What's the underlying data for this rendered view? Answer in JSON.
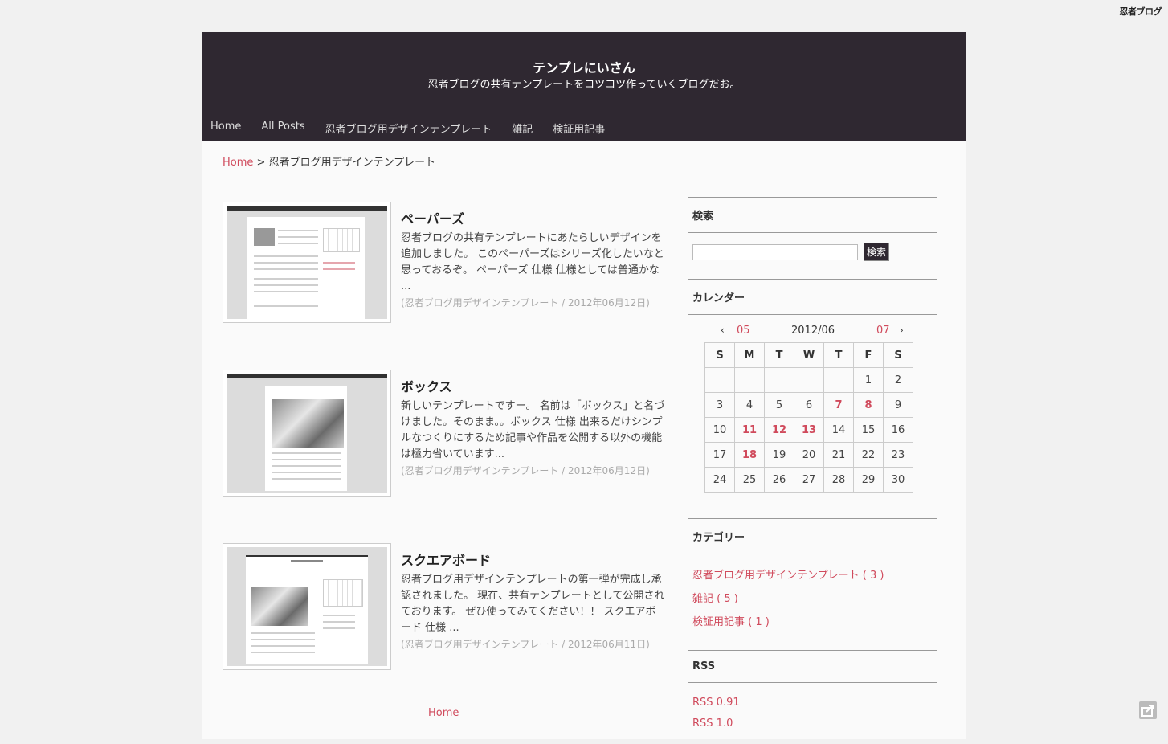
{
  "top_logo": "忍者ブログ",
  "header": {
    "title": "テンプレにいさん",
    "description": "忍者ブログの共有テンプレートをコツコツ作っていくブログだお。",
    "nav": [
      "Home",
      "All Posts",
      "忍者ブログ用デザインテンプレート",
      "雑記",
      "検証用記事"
    ]
  },
  "breadcrumb": {
    "home": "Home",
    "separator": " > ",
    "current": "忍者ブログ用デザインテンプレート"
  },
  "posts": [
    {
      "title": "ペーパーズ",
      "body": "忍者ブログの共有テンプレートにあたらしいデザインを追加しました。 このペーパーズはシリーズ化したいなと思っておるぞ。 ペーパーズ 仕様 仕様としては普通かな ...",
      "meta": "(忍者ブログ用デザインテンプレート / 2012年06月12日)"
    },
    {
      "title": "ボックス",
      "body": "新しいテンプレートですー。 名前は「ボックス」と名づけました。そのまま。。ボックス 仕様 出来るだけシンプルなつくりにするため記事や作品を公開する以外の機能は極力省いています...",
      "meta": "(忍者ブログ用デザインテンプレート / 2012年06月12日)"
    },
    {
      "title": "スクエアボード",
      "body": "忍者ブログ用デザインテンプレートの第一弾が完成し承認されました。 現在、共有テンプレートとして公開されております。 ぜひ使ってみてください！！ スクエアボード 仕様 ...",
      "meta": "(忍者ブログ用デザインテンプレート / 2012年06月11日)"
    }
  ],
  "footer": {
    "home": "Home"
  },
  "sidebar": {
    "search": {
      "title": "検索",
      "button": "検索",
      "value": ""
    },
    "calendar": {
      "title": "カレンダー",
      "prev_arrow": "‹",
      "prev": "05",
      "current": "2012/06",
      "next": "07",
      "next_arrow": "›",
      "weekdays": [
        "S",
        "M",
        "T",
        "W",
        "T",
        "F",
        "S"
      ],
      "weeks": [
        [
          "",
          "",
          "",
          "",
          "",
          "1",
          "2"
        ],
        [
          "3",
          "4",
          "5",
          "6",
          "7",
          "8",
          "9"
        ],
        [
          "10",
          "11",
          "12",
          "13",
          "14",
          "15",
          "16"
        ],
        [
          "17",
          "18",
          "19",
          "20",
          "21",
          "22",
          "23"
        ],
        [
          "24",
          "25",
          "26",
          "27",
          "28",
          "29",
          "30"
        ]
      ],
      "linked_days": [
        "7",
        "8",
        "11",
        "12",
        "13",
        "18"
      ]
    },
    "categories": {
      "title": "カテゴリー",
      "items": [
        "忍者ブログ用デザインテンプレート ( 3 )",
        "雑記 ( 5 )",
        "検証用記事 ( 1 )"
      ]
    },
    "rss": {
      "title": "RSS",
      "items": [
        "RSS 0.91",
        "RSS 1.0"
      ]
    }
  },
  "colors": {
    "header_bg": "#2f2831",
    "link": "#d04a5c",
    "page_bg": "#f1f1f1"
  }
}
